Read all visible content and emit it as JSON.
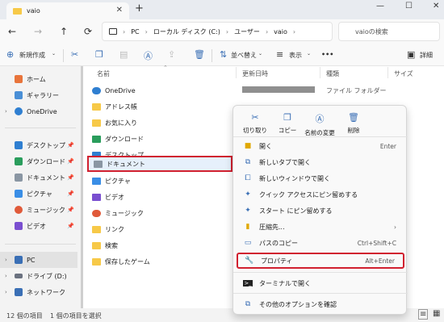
{
  "window": {
    "tab_title": "vaio",
    "new_tab": "+",
    "minimize": "—",
    "maximize": "☐",
    "close": "✕"
  },
  "address": {
    "nav_back": "←",
    "nav_forward": "→",
    "nav_up": "↑",
    "refresh": "⟳",
    "crumbs": [
      "PC",
      "ローカル ディスク (C:)",
      "ユーザー",
      "vaio"
    ],
    "search_placeholder": "vaioの検索"
  },
  "toolbar": {
    "new_label": "新規作成",
    "sort_label": "並べ替え",
    "view_label": "表示",
    "more_label": "•••",
    "details_label": "詳細"
  },
  "nav": {
    "items": [
      {
        "label": "ホーム",
        "color": "#e8743b"
      },
      {
        "label": "ギャラリー",
        "color": "#4a8fd6"
      },
      {
        "label": "OneDrive",
        "color": "#2f7fd1"
      },
      {
        "label": "デスクトップ",
        "color": "#2f7fd1"
      },
      {
        "label": "ダウンロード",
        "color": "#2a9d5c"
      },
      {
        "label": "ドキュメント",
        "color": "#8a96a3"
      },
      {
        "label": "ピクチャ",
        "color": "#3a8ee6"
      },
      {
        "label": "ミュージック",
        "color": "#e05a3a"
      },
      {
        "label": "ビデオ",
        "color": "#7a4fd0"
      },
      {
        "label": "PC",
        "color": "#3a6fb5"
      },
      {
        "label": "ドライブ (D:)",
        "color": "#6b7280"
      },
      {
        "label": "ネットワーク",
        "color": "#3a6fb5"
      }
    ]
  },
  "columns": {
    "name": "名前",
    "modified": "更新日時",
    "type": "種類",
    "size": "サイズ"
  },
  "files": [
    {
      "name": "OneDrive",
      "color": "#2f7fd1"
    },
    {
      "name": "アドレス帳",
      "color": "#f7c948"
    },
    {
      "name": "お気に入り",
      "color": "#f7c948"
    },
    {
      "name": "ダウンロード",
      "color": "#2a9d5c"
    },
    {
      "name": "デスクトップ",
      "color": "#2f7fd1"
    },
    {
      "name": "ドキュメント",
      "color": "#8a96a3"
    },
    {
      "name": "ピクチャ",
      "color": "#3a8ee6"
    },
    {
      "name": "ビデオ",
      "color": "#7a4fd0"
    },
    {
      "name": "ミュージック",
      "color": "#e05a3a"
    },
    {
      "name": "リンク",
      "color": "#f7c948"
    },
    {
      "name": "検索",
      "color": "#f7c948"
    },
    {
      "name": "保存したゲーム",
      "color": "#f7c948"
    }
  ],
  "first_row_type": "ファイル フォルダー",
  "context_menu": {
    "quick": [
      "切り取り",
      "コピー",
      "名前の変更",
      "削除"
    ],
    "items": [
      {
        "label": "開く",
        "shortcut": "Enter"
      },
      {
        "label": "新しいタブで開く",
        "shortcut": ""
      },
      {
        "label": "新しいウィンドウで開く",
        "shortcut": ""
      },
      {
        "label": "クイック アクセスにピン留めする",
        "shortcut": ""
      },
      {
        "label": "スタート にピン留めする",
        "shortcut": ""
      },
      {
        "label": "圧縮先...",
        "shortcut": "›"
      },
      {
        "label": "パスのコピー",
        "shortcut": "Ctrl+Shift+C"
      },
      {
        "label": "プロパティ",
        "shortcut": "Alt+Enter"
      },
      {
        "label": "ターミナルで開く",
        "shortcut": ""
      },
      {
        "label": "その他のオプションを確認",
        "shortcut": ""
      }
    ]
  },
  "status": {
    "count": "12 個の項目",
    "selected": "1 個の項目を選択"
  },
  "colors": {
    "highlight": "#d1202f",
    "accent": "#3a6fb5"
  }
}
